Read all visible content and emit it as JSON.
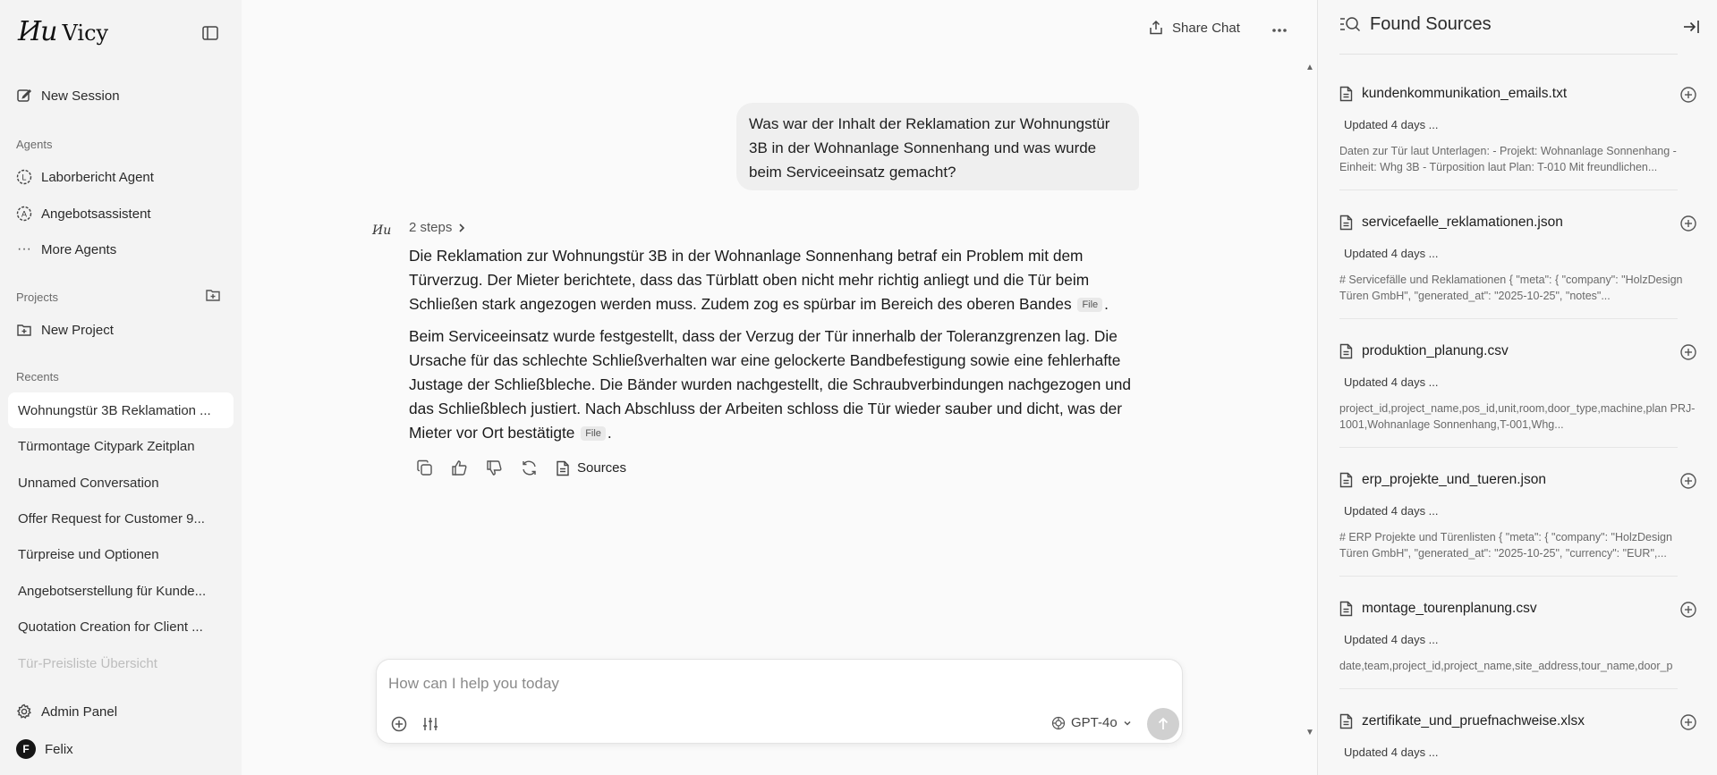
{
  "app": {
    "logo_mark": "Ии",
    "logo_text": "Vicy"
  },
  "sidebar": {
    "new_session": "New Session",
    "agents_heading": "Agents",
    "agents": [
      {
        "label": "Laborbericht Agent",
        "badge": "L"
      },
      {
        "label": "Angebotsassistent",
        "badge": "A"
      }
    ],
    "more_agents": "More Agents",
    "projects_heading": "Projects",
    "new_project": "New Project",
    "recents_heading": "Recents",
    "recents": [
      "Wohnungstür 3B Reklamation ...",
      "Türmontage Citypark Zeitplan",
      "Unnamed Conversation",
      "Offer Request for Customer 9...",
      "Türpreise und Optionen",
      "Angebotserstellung für Kunde...",
      "Quotation Creation for Client ...",
      "Tür-Preisliste Übersicht"
    ],
    "admin_panel": "Admin Panel",
    "user": {
      "name": "Felix",
      "initial": "F"
    }
  },
  "topbar": {
    "share_label": "Share Chat"
  },
  "chat": {
    "user_message": "Was war der Inhalt der Reklamation zur Wohnungstür 3B in der Wohnanlage Sonnenhang und was wurde beim Serviceeinsatz gemacht?",
    "assistant_icon": "Ии",
    "steps_label": "2 steps",
    "answer": {
      "p1": "Die Reklamation zur Wohnungstür 3B in der Wohnanlage Sonnenhang betraf ein Problem mit dem Türverzug. Der Mieter berichtete, dass das Türblatt oben nicht mehr richtig anliegt und die Tür beim Schließen stark angezogen werden muss. Zudem zog es spürbar im Bereich des oberen Bandes",
      "p2": "Beim Serviceeinsatz wurde festgestellt, dass der Verzug der Tür innerhalb der Toleranzgrenzen lag. Die Ursache für das schlechte Schließverhalten war eine gelockerte Bandbefestigung sowie eine fehlerhafte Justage der Schließbleche. Die Bänder wurden nachgestellt, die Schraubverbindungen nachgezogen und das Schließblech justiert. Nach Abschluss der Arbeiten schloss die Tür wieder sauber und dicht, was der Mieter vor Ort bestätigte",
      "file_chip": "File",
      "end_punct": "."
    },
    "sources_label": "Sources"
  },
  "composer": {
    "placeholder": "How can I help you today",
    "model": "GPT-4o"
  },
  "panel": {
    "title": "Found Sources",
    "sources": [
      {
        "name": "kundenkommunikation_emails.txt",
        "updated": "Updated 4 days ...",
        "snippet": "Daten zur Tür laut Unterlagen: - Projekt: Wohnanlage Sonnenhang - Einheit: Whg 3B - Türposition laut Plan: T-010 Mit freundlichen..."
      },
      {
        "name": "servicefaelle_reklamationen.json",
        "updated": "Updated 4 days ...",
        "snippet": "# Servicefälle und Reklamationen { \"meta\": { \"company\": \"HolzDesign Türen GmbH\", \"generated_at\": \"2025-10-25\", \"notes\"..."
      },
      {
        "name": "produktion_planung.csv",
        "updated": "Updated 4 days ...",
        "snippet": "project_id,project_name,pos_id,unit,room,door_type,machine,plan PRJ-1001,Wohnanlage Sonnenhang,T-001,Whg..."
      },
      {
        "name": "erp_projekte_und_tueren.json",
        "updated": "Updated 4 days ...",
        "snippet": "# ERP Projekte und Türenlisten { \"meta\": { \"company\": \"HolzDesign Türen GmbH\", \"generated_at\": \"2025-10-25\", \"currency\": \"EUR\",..."
      },
      {
        "name": "montage_tourenplanung.csv",
        "updated": "Updated 4 days ...",
        "snippet": "date,team,project_id,project_name,site_address,tour_name,door_p"
      },
      {
        "name": "zertifikate_und_pruefnachweise.xlsx",
        "updated": "Updated 4 days ...",
        "snippet": ""
      }
    ]
  }
}
